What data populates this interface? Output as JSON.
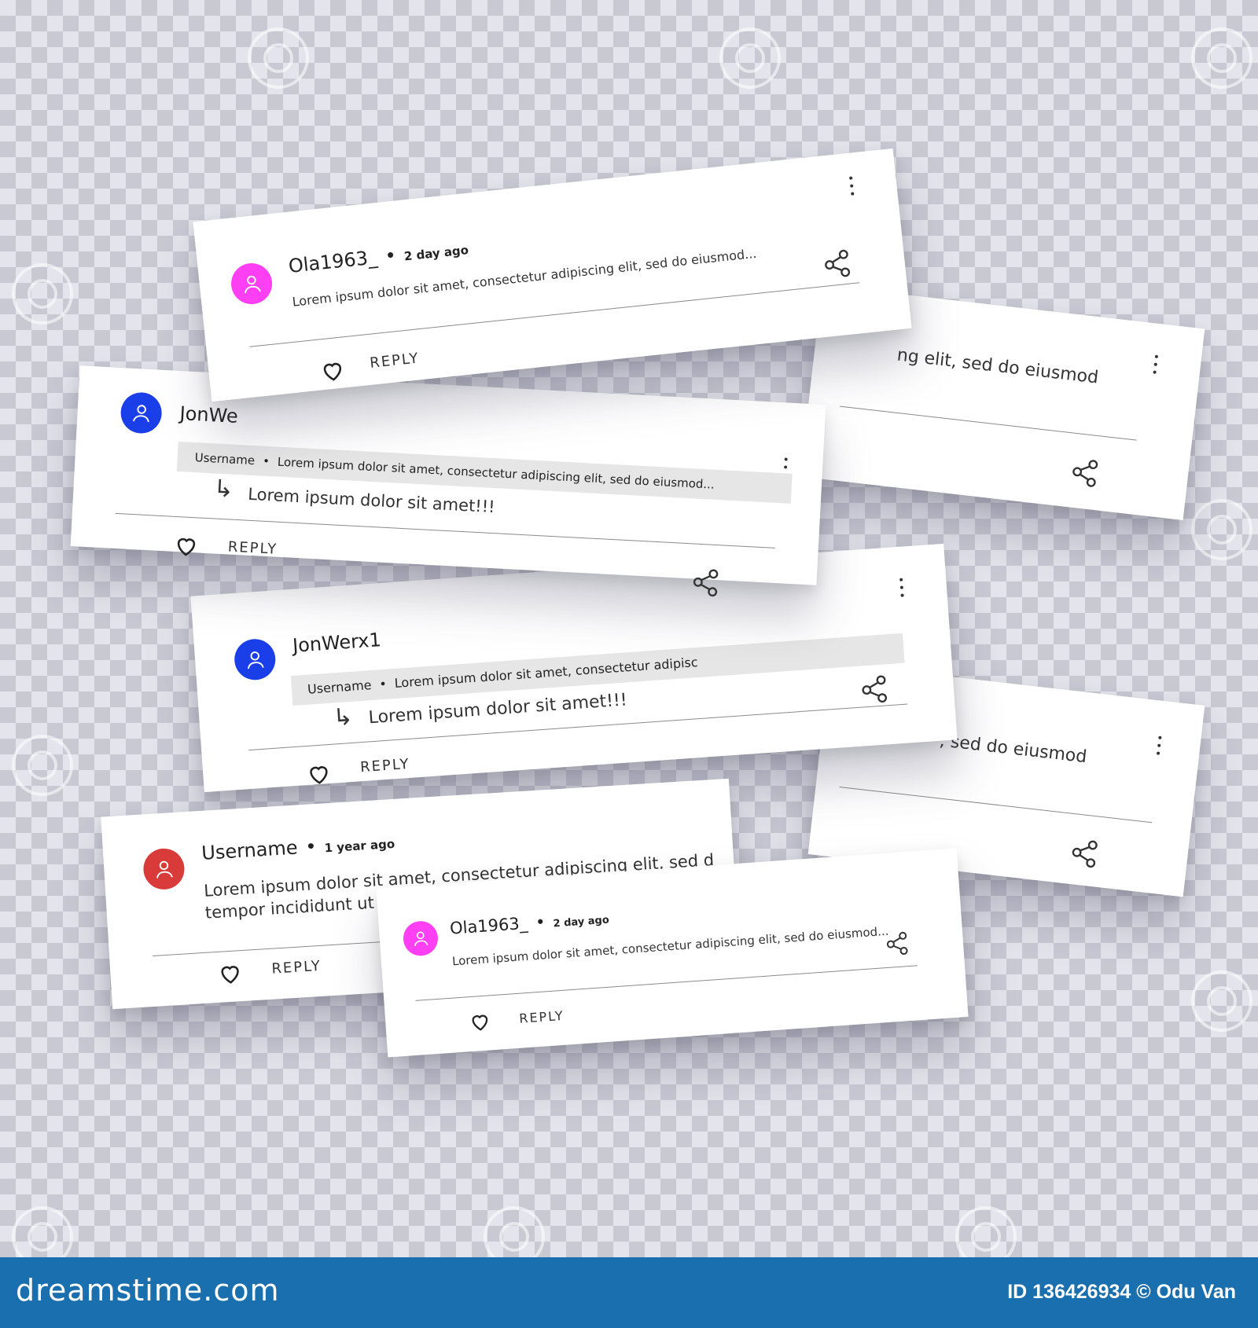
{
  "cards": {
    "c1": {
      "user": "Ola1963_",
      "time": "2 day ago",
      "text": "Lorem ipsum dolor sit amet, consectetur adipiscing elit, sed do  eiusmod...",
      "reply": "REPLY",
      "avatar_color": "#ff3ff3"
    },
    "c2": {
      "text": "ng elit, sed do  eiusmod"
    },
    "c3": {
      "user": "JonWe",
      "quote_user": "Username",
      "quote_text": "Lorem ipsum dolor sit amet, consectetur adipiscing elit, sed do  eiusmod...",
      "reply_text": "Lorem ipsum dolor sit amet!!!",
      "reply": "REPLY",
      "avatar_color": "#1a3ee8"
    },
    "c4": {
      "user": "JonWerx1",
      "quote_user": "Username",
      "quote_text": "Lorem ipsum dolor sit amet, consectetur adipisc",
      "reply_text": "Lorem ipsum dolor sit amet!!!",
      "reply": "REPLY",
      "avatar_color": "#1a3ee8"
    },
    "c5": {
      "text": ", sed do  eiusmod"
    },
    "c6": {
      "user": "Username",
      "time": "1 year ago",
      "text1": "Lorem ipsum dolor sit amet, consectetur adipiscing elit, sed d",
      "text2": "tempor incididunt ut labore",
      "reply": "REPLY",
      "avatar_color": "#d93a3a"
    },
    "c7": {
      "user": "Ola1963_",
      "time": "2 day ago",
      "text": "Lorem ipsum dolor sit amet, consectetur adipiscing elit, sed do  eiusmod...",
      "reply": "REPLY",
      "avatar_color": "#ff3ff3"
    }
  },
  "footer": {
    "logo": "dreamstime.com",
    "credit": "ID 136426934 © Odu Van"
  }
}
